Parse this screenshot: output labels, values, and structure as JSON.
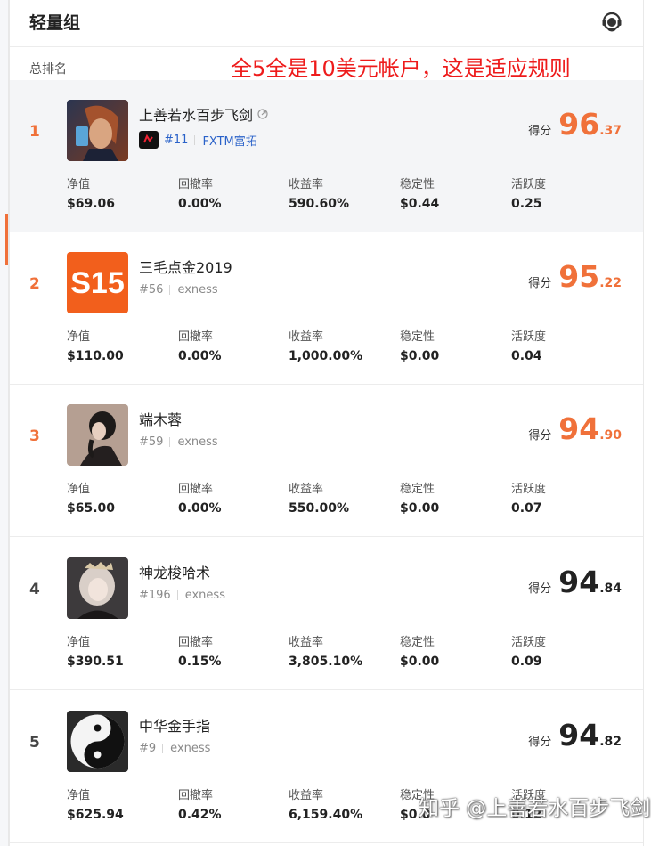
{
  "header": {
    "title": "轻量组",
    "support_icon": "customer-service-icon"
  },
  "subhead": {
    "rank_label": "总排名",
    "annotation": "全5全是10美元帐户，这是适应规则"
  },
  "score_label": "得分",
  "stat_labels": [
    "净值",
    "回撤率",
    "收益率",
    "稳定性",
    "活跃度"
  ],
  "colors": {
    "accent": "#f0713a",
    "top_rank": "#f0713a",
    "normal_rank": "#444444",
    "link": "#2a62c9",
    "annotation": "#ee1b1b"
  },
  "rows": [
    {
      "rank": "1",
      "name": "上善若水百步飞剑",
      "rank_no": "#11",
      "broker": "FXTM富拓",
      "score_int": "96",
      "score_dec": ".37",
      "stats": [
        "$69.06",
        "0.00%",
        "590.60%",
        "$0.44",
        "0.25"
      ]
    },
    {
      "rank": "2",
      "name": "三毛点金2019",
      "rank_no": "#56",
      "broker": "exness",
      "score_int": "95",
      "score_dec": ".22",
      "avatar_text": "S15",
      "stats": [
        "$110.00",
        "0.00%",
        "1,000.00%",
        "$0.00",
        "0.04"
      ]
    },
    {
      "rank": "3",
      "name": "端木蓉",
      "rank_no": "#59",
      "broker": "exness",
      "score_int": "94",
      "score_dec": ".90",
      "stats": [
        "$65.00",
        "0.00%",
        "550.00%",
        "$0.00",
        "0.07"
      ]
    },
    {
      "rank": "4",
      "name": "神龙梭哈术",
      "rank_no": "#196",
      "broker": "exness",
      "score_int": "94",
      "score_dec": ".84",
      "stats": [
        "$390.51",
        "0.15%",
        "3,805.10%",
        "$0.00",
        "0.09"
      ]
    },
    {
      "rank": "5",
      "name": "中华金手指",
      "rank_no": "#9",
      "broker": "exness",
      "score_int": "94",
      "score_dec": ".82",
      "stats": [
        "$625.94",
        "0.42%",
        "6,159.40%",
        "$0.0",
        "0.12"
      ]
    }
  ],
  "watermark": "知乎 @上善若水百步飞剑"
}
